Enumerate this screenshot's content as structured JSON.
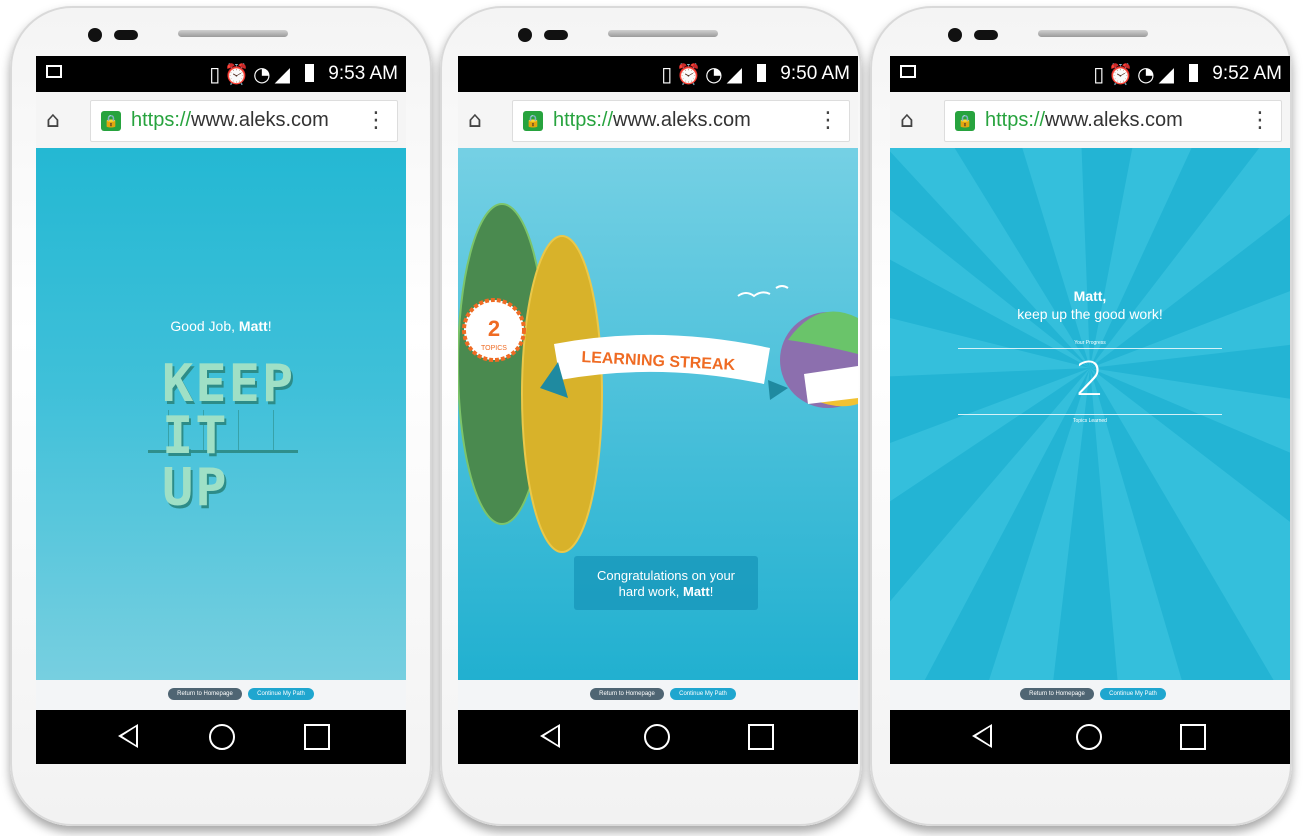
{
  "phones": [
    {
      "status": {
        "time": "9:53 AM"
      },
      "browser": {
        "url_scheme": "https://",
        "url_host": "www.aleks.com"
      },
      "screen": {
        "greeting_prefix": "Good Job,",
        "greeting_name": "Matt",
        "greeting_suffix": "!",
        "headline_line1": "KEEP",
        "headline_line2": "IT UP"
      },
      "footer": {
        "return_label": "Return to Homepage",
        "continue_label": "Continue My Path"
      }
    },
    {
      "status": {
        "time": "9:50 AM"
      },
      "browser": {
        "url_scheme": "https://",
        "url_host": "www.aleks.com"
      },
      "screen": {
        "badge_number": "2",
        "badge_label": "TOPICS",
        "banner_text": "LEARNING STREAK",
        "congrats_line1": "Congratulations on your",
        "congrats_line2_prefix": "hard work,",
        "congrats_name": "Matt",
        "congrats_suffix": "!"
      },
      "footer": {
        "return_label": "Return to Homepage",
        "continue_label": "Continue My Path"
      }
    },
    {
      "status": {
        "time": "9:52 AM"
      },
      "browser": {
        "url_scheme": "https://",
        "url_host": "www.aleks.com"
      },
      "screen": {
        "name": "Matt,",
        "message": "keep up the good work!",
        "progress_label": "Your Progress",
        "progress_value": "2",
        "progress_caption": "Topics Learned"
      },
      "footer": {
        "return_label": "Return to Homepage",
        "continue_label": "Continue My Path"
      }
    }
  ],
  "colors": {
    "secure_green": "#27a33e",
    "cyan_bg": "#23b4d4",
    "button_dark": "#4f6573",
    "button_cyan": "#1fa6cf",
    "banner_orange": "#ef6b23"
  },
  "icons": [
    "image-icon",
    "vibrate-icon",
    "alarm-icon",
    "wifi-icon",
    "signal-icon",
    "battery-icon",
    "home-icon",
    "lock-icon",
    "menu-dots-icon",
    "back-icon",
    "home-circle-icon",
    "recent-apps-icon"
  ]
}
